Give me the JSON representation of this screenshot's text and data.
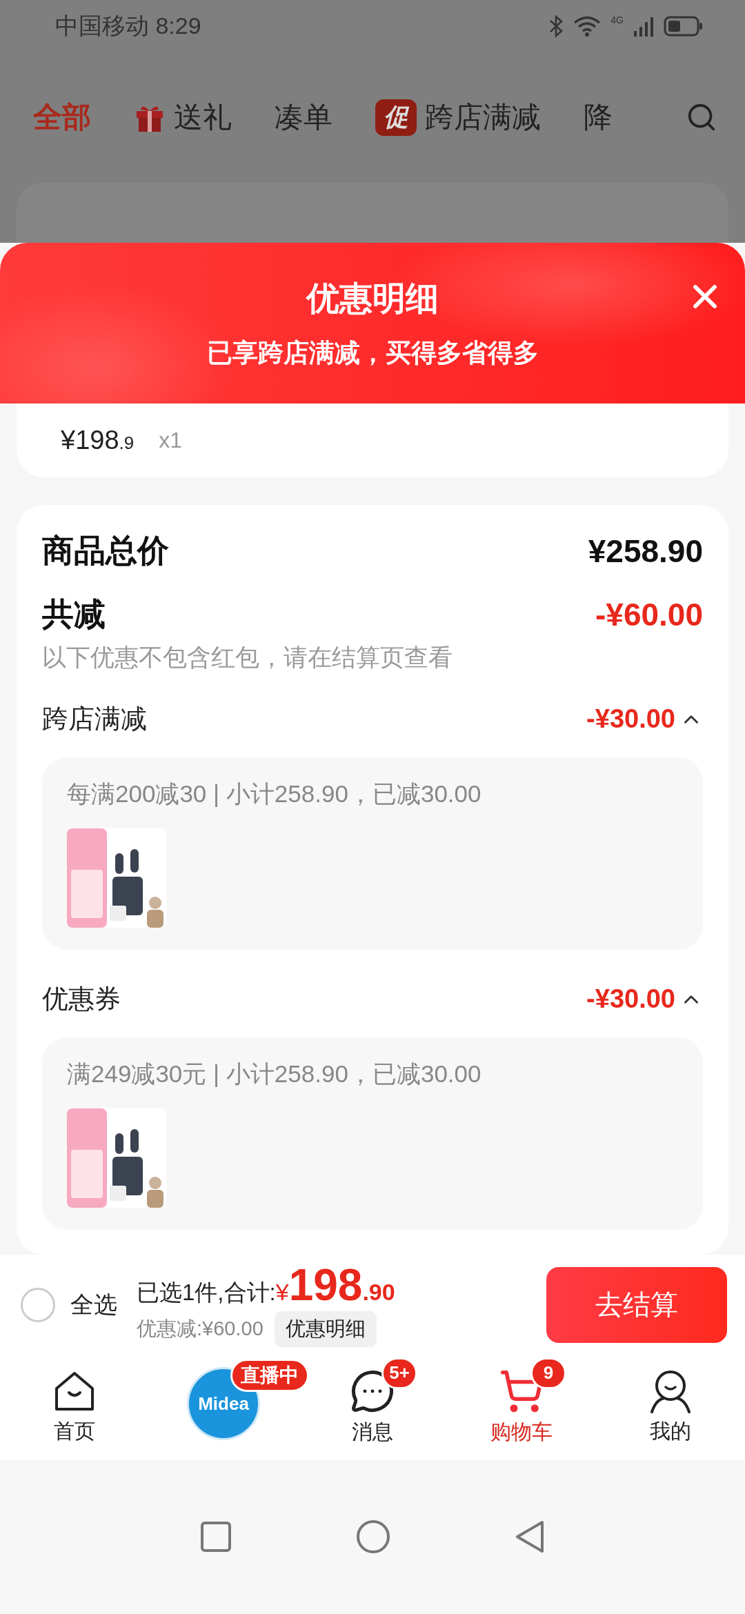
{
  "status_bar": {
    "carrier": "中国移动",
    "time": "8:29",
    "network": "4G"
  },
  "filter_tabs": [
    {
      "label": "全部",
      "kind": "plain",
      "selected": true
    },
    {
      "label": "送礼",
      "kind": "gift",
      "selected": false
    },
    {
      "label": "凑单",
      "kind": "plain",
      "selected": false
    },
    {
      "label": "跨店满减",
      "kind": "promo",
      "badge": "促",
      "selected": false
    },
    {
      "label": "降",
      "kind": "plain",
      "selected": false
    }
  ],
  "promo_sheet": {
    "title": "优惠明细",
    "subtitle": "已享跨店满减，买得多省得多",
    "item": {
      "price": "¥198",
      "price_decimal": ".9",
      "quantity": "x1"
    },
    "summary": {
      "total_label": "商品总价",
      "total": "¥258.90",
      "discount_label": "共减",
      "discount": "-¥60.00",
      "note": "以下优惠不包含红包，请在结算页查看"
    },
    "groups": [
      {
        "label": "跨店满减",
        "amount": "-¥30.00",
        "expanded": true,
        "rule": "每满200减30 | 小计258.90，已减30.00"
      },
      {
        "label": "优惠券",
        "amount": "-¥30.00",
        "expanded": true,
        "rule": "满249减30元 | 小计258.90，已减30.00"
      }
    ]
  },
  "checkout_bar": {
    "select_all": {
      "label": "全选",
      "checked": false
    },
    "selected_text": "已选1件,合计:",
    "currency": "¥",
    "total_int": "198",
    "total_dec": ".90",
    "discount": "优惠减:¥60.00",
    "detail_button": "优惠明细",
    "checkout_button": "去结算"
  },
  "bottom_nav": [
    {
      "kind": "home",
      "label": "首页",
      "selected": false
    },
    {
      "kind": "live",
      "logo": "Midea",
      "badge": "直播中",
      "selected": false
    },
    {
      "kind": "message",
      "label": "消息",
      "badge": "5+",
      "selected": false
    },
    {
      "kind": "cart",
      "label": "购物车",
      "badge": "9",
      "selected": true
    },
    {
      "kind": "profile",
      "label": "我的",
      "selected": false
    }
  ]
}
